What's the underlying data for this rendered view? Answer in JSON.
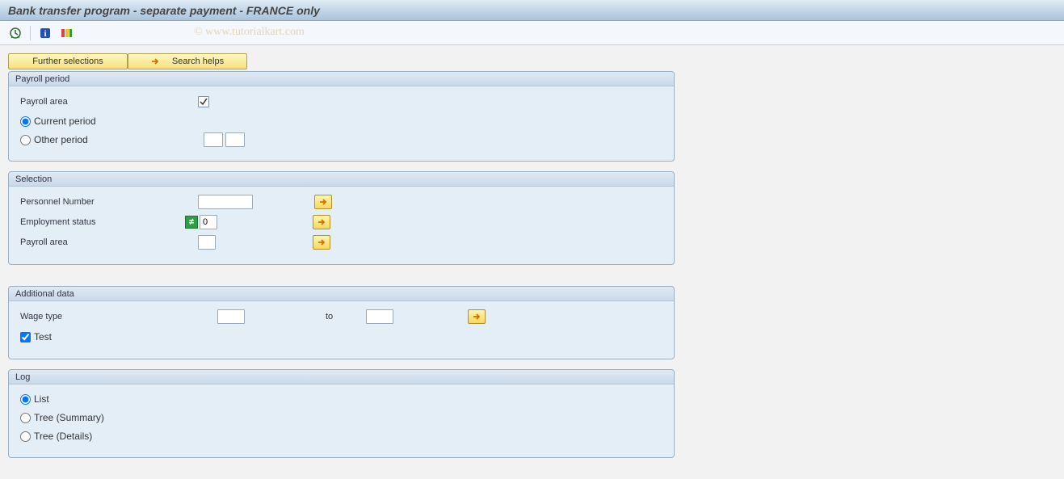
{
  "title": "Bank transfer program - separate payment - FRANCE only",
  "watermark": "© www.tutorialkart.com",
  "toolbar": {
    "execute_icon": "execute",
    "info_icon": "info",
    "status_icon": "status"
  },
  "buttons": {
    "further_selections": "Further selections",
    "search_helps": "Search helps"
  },
  "groups": {
    "payroll_period": {
      "title": "Payroll period",
      "payroll_area_label": "Payroll area",
      "payroll_area_checked": true,
      "current_period": "Current period",
      "other_period": "Other period",
      "selected_period": "current",
      "other_period_val1": "",
      "other_period_val2": ""
    },
    "selection": {
      "title": "Selection",
      "personnel_number_label": "Personnel Number",
      "personnel_number_val": "",
      "employment_status_label": "Employment status",
      "employment_status_val": "0",
      "employment_status_operator": "not-equal",
      "payroll_area_label": "Payroll area",
      "payroll_area_val": ""
    },
    "additional": {
      "title": "Additional data",
      "wage_type_label": "Wage type",
      "wage_type_from": "",
      "to_label": "to",
      "wage_type_to": "",
      "test_label": "Test",
      "test_checked": true
    },
    "log": {
      "title": "Log",
      "list": "List",
      "tree_summary": "Tree (Summary)",
      "tree_details": "Tree (Details)",
      "selected": "list"
    }
  }
}
